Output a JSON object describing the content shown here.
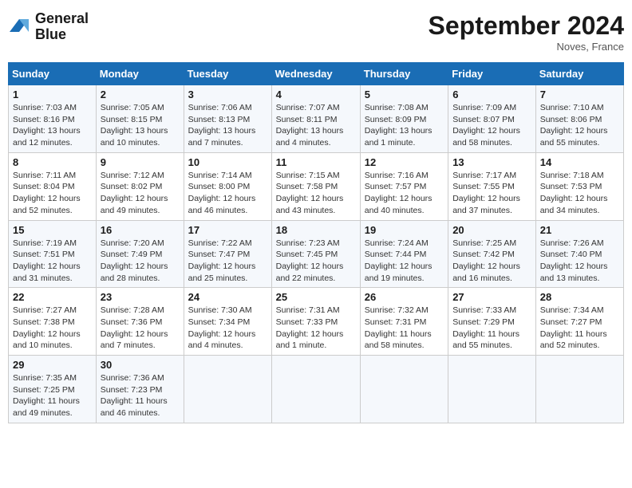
{
  "logo": {
    "line1": "General",
    "line2": "Blue"
  },
  "title": "September 2024",
  "subtitle": "Noves, France",
  "days_header": [
    "Sunday",
    "Monday",
    "Tuesday",
    "Wednesday",
    "Thursday",
    "Friday",
    "Saturday"
  ],
  "weeks": [
    [
      {
        "day": "1",
        "info": "Sunrise: 7:03 AM\nSunset: 8:16 PM\nDaylight: 13 hours\nand 12 minutes."
      },
      {
        "day": "2",
        "info": "Sunrise: 7:05 AM\nSunset: 8:15 PM\nDaylight: 13 hours\nand 10 minutes."
      },
      {
        "day": "3",
        "info": "Sunrise: 7:06 AM\nSunset: 8:13 PM\nDaylight: 13 hours\nand 7 minutes."
      },
      {
        "day": "4",
        "info": "Sunrise: 7:07 AM\nSunset: 8:11 PM\nDaylight: 13 hours\nand 4 minutes."
      },
      {
        "day": "5",
        "info": "Sunrise: 7:08 AM\nSunset: 8:09 PM\nDaylight: 13 hours\nand 1 minute."
      },
      {
        "day": "6",
        "info": "Sunrise: 7:09 AM\nSunset: 8:07 PM\nDaylight: 12 hours\nand 58 minutes."
      },
      {
        "day": "7",
        "info": "Sunrise: 7:10 AM\nSunset: 8:06 PM\nDaylight: 12 hours\nand 55 minutes."
      }
    ],
    [
      {
        "day": "8",
        "info": "Sunrise: 7:11 AM\nSunset: 8:04 PM\nDaylight: 12 hours\nand 52 minutes."
      },
      {
        "day": "9",
        "info": "Sunrise: 7:12 AM\nSunset: 8:02 PM\nDaylight: 12 hours\nand 49 minutes."
      },
      {
        "day": "10",
        "info": "Sunrise: 7:14 AM\nSunset: 8:00 PM\nDaylight: 12 hours\nand 46 minutes."
      },
      {
        "day": "11",
        "info": "Sunrise: 7:15 AM\nSunset: 7:58 PM\nDaylight: 12 hours\nand 43 minutes."
      },
      {
        "day": "12",
        "info": "Sunrise: 7:16 AM\nSunset: 7:57 PM\nDaylight: 12 hours\nand 40 minutes."
      },
      {
        "day": "13",
        "info": "Sunrise: 7:17 AM\nSunset: 7:55 PM\nDaylight: 12 hours\nand 37 minutes."
      },
      {
        "day": "14",
        "info": "Sunrise: 7:18 AM\nSunset: 7:53 PM\nDaylight: 12 hours\nand 34 minutes."
      }
    ],
    [
      {
        "day": "15",
        "info": "Sunrise: 7:19 AM\nSunset: 7:51 PM\nDaylight: 12 hours\nand 31 minutes."
      },
      {
        "day": "16",
        "info": "Sunrise: 7:20 AM\nSunset: 7:49 PM\nDaylight: 12 hours\nand 28 minutes."
      },
      {
        "day": "17",
        "info": "Sunrise: 7:22 AM\nSunset: 7:47 PM\nDaylight: 12 hours\nand 25 minutes."
      },
      {
        "day": "18",
        "info": "Sunrise: 7:23 AM\nSunset: 7:45 PM\nDaylight: 12 hours\nand 22 minutes."
      },
      {
        "day": "19",
        "info": "Sunrise: 7:24 AM\nSunset: 7:44 PM\nDaylight: 12 hours\nand 19 minutes."
      },
      {
        "day": "20",
        "info": "Sunrise: 7:25 AM\nSunset: 7:42 PM\nDaylight: 12 hours\nand 16 minutes."
      },
      {
        "day": "21",
        "info": "Sunrise: 7:26 AM\nSunset: 7:40 PM\nDaylight: 12 hours\nand 13 minutes."
      }
    ],
    [
      {
        "day": "22",
        "info": "Sunrise: 7:27 AM\nSunset: 7:38 PM\nDaylight: 12 hours\nand 10 minutes."
      },
      {
        "day": "23",
        "info": "Sunrise: 7:28 AM\nSunset: 7:36 PM\nDaylight: 12 hours\nand 7 minutes."
      },
      {
        "day": "24",
        "info": "Sunrise: 7:30 AM\nSunset: 7:34 PM\nDaylight: 12 hours\nand 4 minutes."
      },
      {
        "day": "25",
        "info": "Sunrise: 7:31 AM\nSunset: 7:33 PM\nDaylight: 12 hours\nand 1 minute."
      },
      {
        "day": "26",
        "info": "Sunrise: 7:32 AM\nSunset: 7:31 PM\nDaylight: 11 hours\nand 58 minutes."
      },
      {
        "day": "27",
        "info": "Sunrise: 7:33 AM\nSunset: 7:29 PM\nDaylight: 11 hours\nand 55 minutes."
      },
      {
        "day": "28",
        "info": "Sunrise: 7:34 AM\nSunset: 7:27 PM\nDaylight: 11 hours\nand 52 minutes."
      }
    ],
    [
      {
        "day": "29",
        "info": "Sunrise: 7:35 AM\nSunset: 7:25 PM\nDaylight: 11 hours\nand 49 minutes."
      },
      {
        "day": "30",
        "info": "Sunrise: 7:36 AM\nSunset: 7:23 PM\nDaylight: 11 hours\nand 46 minutes."
      },
      {
        "day": "",
        "info": ""
      },
      {
        "day": "",
        "info": ""
      },
      {
        "day": "",
        "info": ""
      },
      {
        "day": "",
        "info": ""
      },
      {
        "day": "",
        "info": ""
      }
    ]
  ]
}
